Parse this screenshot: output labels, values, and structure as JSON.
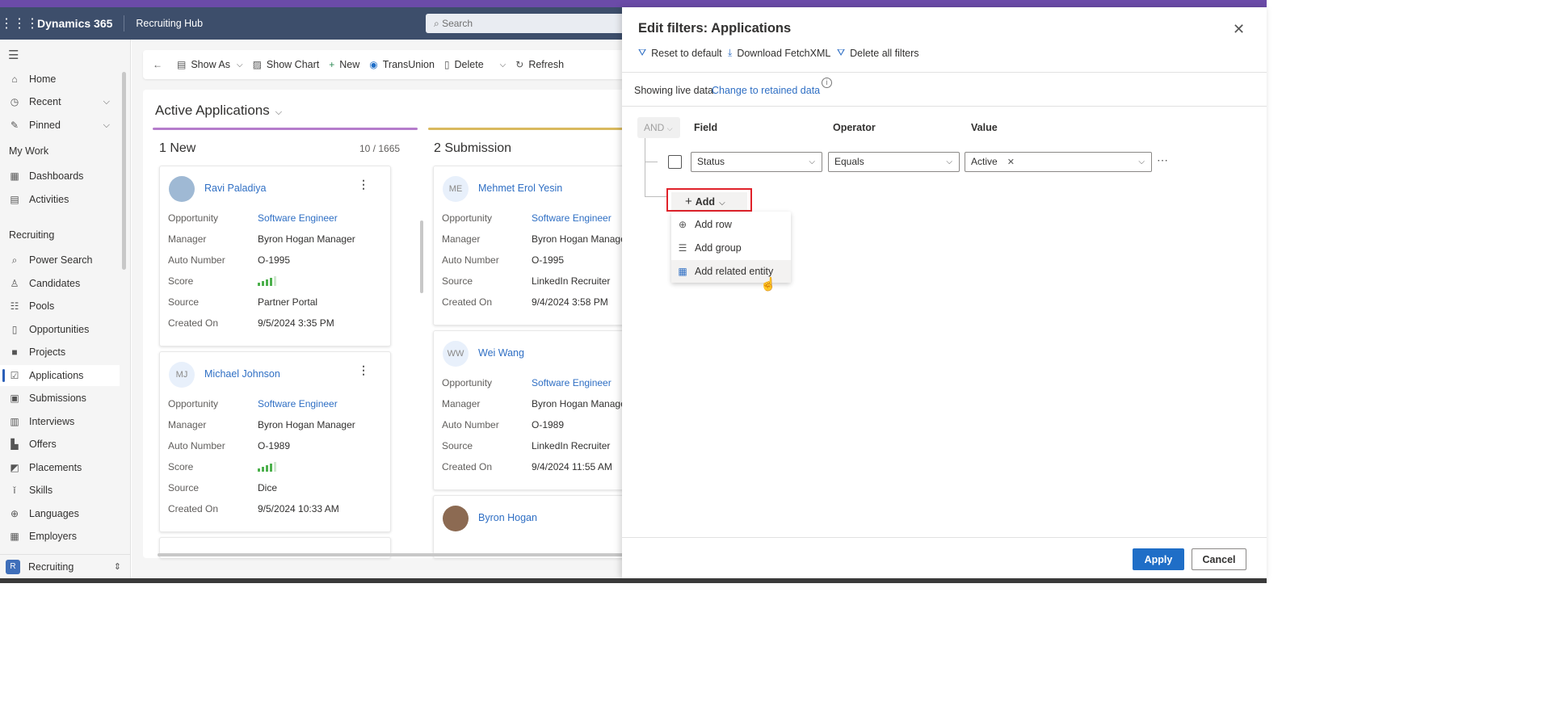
{
  "topbar": {
    "brand": "Dynamics 365",
    "app_name": "Recruiting Hub",
    "search_placeholder": "Search"
  },
  "sidebar": {
    "items_top": [
      {
        "label": "Home",
        "icon": "home-icon"
      },
      {
        "label": "Recent",
        "icon": "clock-icon"
      },
      {
        "label": "Pinned",
        "icon": "pin-icon"
      }
    ],
    "my_work_title": "My Work",
    "my_work": [
      {
        "label": "Dashboards",
        "icon": "dashboard-icon"
      },
      {
        "label": "Activities",
        "icon": "clipboard-icon"
      }
    ],
    "recruiting_title": "Recruiting",
    "recruiting": [
      {
        "label": "Power Search"
      },
      {
        "label": "Candidates"
      },
      {
        "label": "Pools"
      },
      {
        "label": "Opportunities"
      },
      {
        "label": "Projects"
      },
      {
        "label": "Applications"
      },
      {
        "label": "Submissions"
      },
      {
        "label": "Interviews"
      },
      {
        "label": "Offers"
      },
      {
        "label": "Placements"
      },
      {
        "label": "Skills"
      },
      {
        "label": "Languages"
      },
      {
        "label": "Employers"
      }
    ],
    "area": {
      "badge": "R",
      "label": "Recruiting"
    }
  },
  "commands": {
    "show_as": "Show As",
    "show_chart": "Show Chart",
    "new": "New",
    "transunion": "TransUnion",
    "delete": "Delete",
    "refresh": "Refresh"
  },
  "board": {
    "view_title": "Active Applications",
    "lanes": [
      {
        "title": "1 New",
        "count": "10 / 1665"
      },
      {
        "title": "2 Submission"
      }
    ],
    "labels": {
      "opportunity": "Opportunity",
      "manager": "Manager",
      "auto_number": "Auto Number",
      "score": "Score",
      "source": "Source",
      "created_on": "Created On"
    },
    "cards_new": [
      {
        "name": "Ravi Paladiya",
        "initials": "",
        "opportunity": "Software Engineer",
        "manager": "Byron Hogan Manager",
        "auto_number": "O-1995",
        "score": 4,
        "source": "Partner Portal",
        "created_on": "9/5/2024 3:35 PM"
      },
      {
        "name": "Michael Johnson",
        "initials": "MJ",
        "opportunity": "Software Engineer",
        "manager": "Byron Hogan Manager",
        "auto_number": "O-1989",
        "score": 4,
        "source": "Dice",
        "created_on": "9/5/2024 10:33 AM"
      }
    ],
    "cards_submission": [
      {
        "name": "Mehmet Erol Yesin",
        "initials": "ME",
        "opportunity": "Software Engineer",
        "manager": "Byron Hogan Manager",
        "auto_number": "O-1995",
        "source": "LinkedIn Recruiter",
        "created_on": "9/4/2024 3:58 PM"
      },
      {
        "name": "Wei Wang",
        "initials": "WW",
        "opportunity": "Software Engineer",
        "manager": "Byron Hogan Manager",
        "auto_number": "O-1989",
        "source": "LinkedIn Recruiter",
        "created_on": "9/4/2024 11:55 AM"
      },
      {
        "name": "Byron Hogan",
        "initials": ""
      }
    ]
  },
  "filter_panel": {
    "title": "Edit filters: Applications",
    "toolbar": {
      "reset": "Reset to default",
      "download": "Download FetchXML",
      "delete_all": "Delete all filters"
    },
    "live_text": "Showing live data",
    "live_link": "Change to retained data",
    "and_label": "AND",
    "headers": {
      "field": "Field",
      "operator": "Operator",
      "value": "Value"
    },
    "row": {
      "field": "Status",
      "operator": "Equals",
      "value": "Active"
    },
    "add_label": "Add",
    "menu": [
      {
        "label": "Add row",
        "icon": "add-circle-icon"
      },
      {
        "label": "Add group",
        "icon": "group-lines-icon"
      },
      {
        "label": "Add related entity",
        "icon": "related-entity-icon"
      }
    ],
    "apply": "Apply",
    "cancel": "Cancel"
  }
}
